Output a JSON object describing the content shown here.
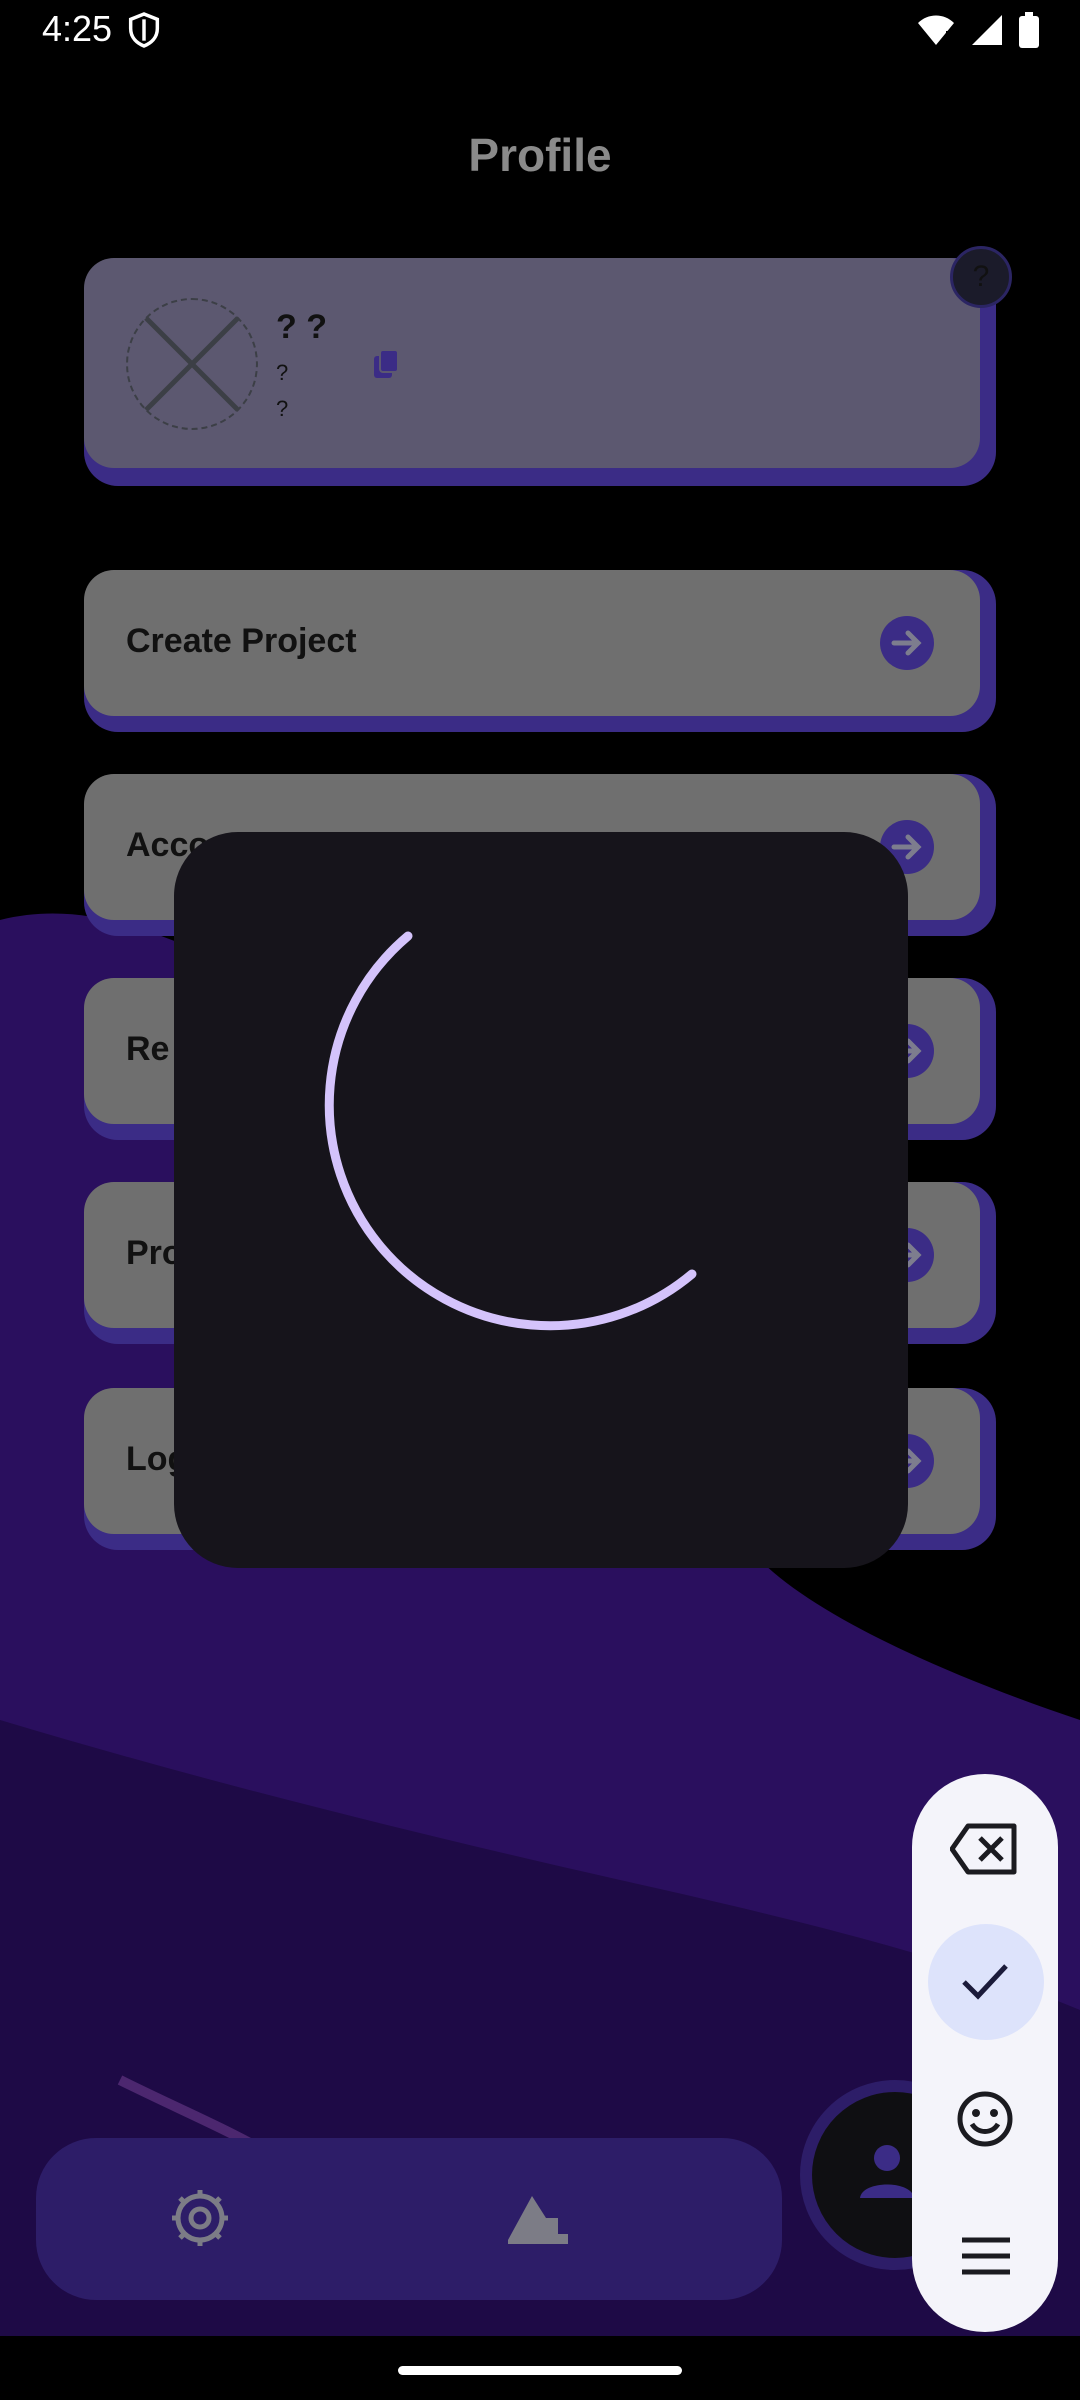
{
  "status": {
    "time": "4:25"
  },
  "page": {
    "title": "Profile"
  },
  "profile": {
    "name": "? ?",
    "line1": "?",
    "line2": "?",
    "help_badge": "?"
  },
  "menu": [
    {
      "label": "Create Project"
    },
    {
      "label": "Acco"
    },
    {
      "label": "Re"
    },
    {
      "label": "Pro"
    },
    {
      "label": "Log"
    }
  ],
  "colors": {
    "accent": "#3b2c86",
    "spinner": "#d4c3fb",
    "toolbar_bg": "#f4f4fa"
  },
  "icons": {
    "status": [
      "shield-icon",
      "wifi-icon",
      "signal-icon",
      "battery-icon"
    ],
    "bottom_nav": [
      "settings-icon",
      "projects-icon",
      "profile-icon"
    ],
    "toolbar": [
      "backspace-icon",
      "check-icon",
      "emoji-icon",
      "menu-icon"
    ]
  }
}
